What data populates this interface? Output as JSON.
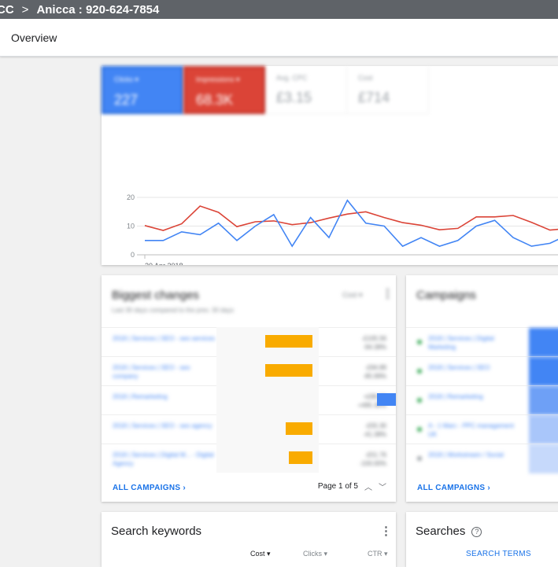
{
  "topbar": {
    "crumb1": "CC",
    "separator": ">",
    "crumb2": "Anicca : 920-624-7854"
  },
  "page": {
    "title": "Overview"
  },
  "metrics": [
    {
      "label": "Clicks ▾",
      "value": "227"
    },
    {
      "label": "Impressions ▾",
      "value": "68.3K"
    },
    {
      "label": "Avg. CPC",
      "value": "£3.15"
    },
    {
      "label": "Cost",
      "value": "£714"
    }
  ],
  "colors": {
    "clicks": "#4285f4",
    "impressions": "#db4437",
    "link": "#1a73e8",
    "bar_orange": "#f9ab00"
  },
  "chart_data": {
    "type": "line",
    "x_tick_labels": [
      "20 Apr 2018"
    ],
    "ylim": [
      0,
      20
    ],
    "y_ticks": [
      0,
      10,
      20
    ],
    "grid": true,
    "series": [
      {
        "values": [
          5,
          5,
          8,
          7,
          11,
          5,
          10,
          14,
          3,
          13,
          6,
          19,
          11,
          10,
          3,
          6,
          3,
          5,
          10,
          12,
          6,
          3,
          4,
          7
        ]
      },
      {
        "values": [
          10.2,
          8.5,
          10.8,
          17,
          14.8,
          9.8,
          11.5,
          11.8,
          10.5,
          11.2,
          12.8,
          14.2,
          15,
          13,
          11.2,
          10.3,
          8.7,
          9.2,
          13.2,
          13.2,
          13.7,
          11.3,
          8.6,
          9.2
        ]
      }
    ]
  },
  "changes": {
    "title": "Biggest changes",
    "subtitle": "Last 30 days compared to the prev. 30 days",
    "sort_label": "Cost ▾",
    "rows": [
      {
        "name": "2018 | Services | SEO - seo services",
        "value": "-£105.56",
        "pct": "-94.38%"
      },
      {
        "name": "2018 | Services | SEO - seo company",
        "value": "-£94.89",
        "pct": "-85.99%"
      },
      {
        "name": "2018 | Remarketing",
        "value": "+£86.56",
        "pct": "+495.38%"
      },
      {
        "name": "2018 | Services | SEO - seo agency",
        "value": "-£55.30",
        "pct": "-41.38%"
      },
      {
        "name": "2018 | Services | Digital M... - Digital Agency",
        "value": "-£51.76",
        "pct": "-100.00%"
      }
    ],
    "bars": [
      {
        "side": "neg",
        "magnitude": 0.8,
        "color": "#f9ab00"
      },
      {
        "side": "neg",
        "magnitude": 0.8,
        "color": "#f9ab00"
      },
      {
        "side": "pos",
        "magnitude": 0.8,
        "color": "#4285f4"
      },
      {
        "side": "neg",
        "magnitude": 0.45,
        "color": "#f9ab00"
      },
      {
        "side": "neg",
        "magnitude": 0.4,
        "color": "#f9ab00"
      }
    ],
    "footer_link": "ALL CAMPAIGNS",
    "pager": "Page 1 of 5"
  },
  "campaigns": {
    "title": "Campaigns",
    "rows": [
      {
        "name": "2018 | Services | Digital Marketing",
        "status": "#34a853"
      },
      {
        "name": "2018 | Services | SEO",
        "status": "#34a853"
      },
      {
        "name": "2018 | Remarketing",
        "status": "#34a853"
      },
      {
        "name": "A - 1 Marc - PPC management UK",
        "status": "#34a853"
      },
      {
        "name": "2018 | Workstream / Social",
        "status": "#9aa0a6"
      }
    ],
    "footer_link": "ALL CAMPAIGNS"
  },
  "keywords": {
    "title": "Search keywords",
    "columns": [
      "Cost ▾",
      "Clicks ▾",
      "CTR ▾"
    ]
  },
  "searches": {
    "title": "Searches",
    "link": "SEARCH TERMS"
  }
}
